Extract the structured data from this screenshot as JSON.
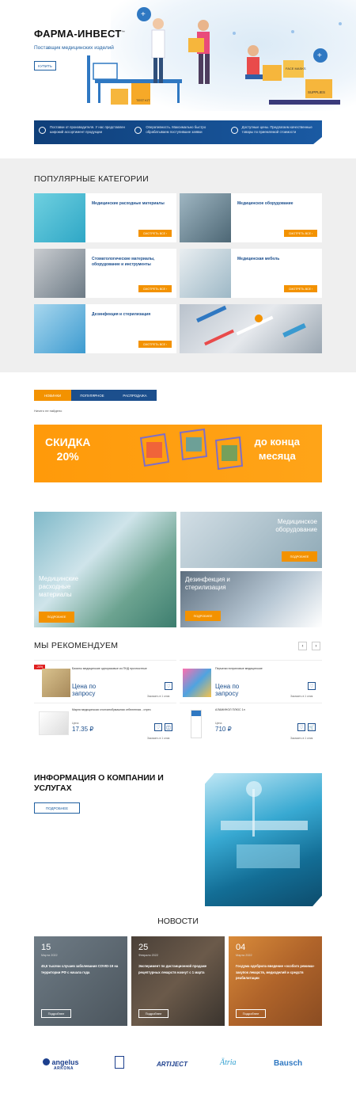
{
  "hero": {
    "title": "ФАРМА-ИНВЕСТ",
    "title_tm": "™",
    "subtitle": "Поставщик медицинских изделий",
    "buy_button": "КУПИТЬ",
    "sign_test_kit": "TEST KIT",
    "sign_face_masks": "FACE MASKS",
    "sign_supplies": "SUPPLIES"
  },
  "features": [
    {
      "icon": "truck-icon",
      "text": "Поставки от производителя. У нас представлен широкий ассортимент продукции"
    },
    {
      "icon": "handshake-icon",
      "text": "Оперативность. Максимально быстро обрабатываем поступившие заявки"
    },
    {
      "icon": "price-icon",
      "text": "Доступные цены. Предлагаем качественные товары по приемлемой стоимости"
    }
  ],
  "categories": {
    "title": "ПОПУЛЯРНЫЕ КАТЕГОРИИ",
    "button_label": "СМОТРЕТЬ ВСЕ",
    "items": [
      {
        "name": "Медицинские расходные материалы"
      },
      {
        "name": "Медицинское оборудование"
      },
      {
        "name": "Стоматологические материалы, оборудование и инструменты"
      },
      {
        "name": "Медицинская мебель"
      },
      {
        "name": "Дезинфекция и стерилизация"
      }
    ]
  },
  "tabs": {
    "items": [
      "НОВИНКИ",
      "ПОПУЛЯРНОЕ",
      "РАСПРОДАЖА"
    ],
    "empty_text": "Ничего не найдено"
  },
  "promo": {
    "left_line1": "СКИДКА",
    "left_line2": "20%",
    "right_line1": "до конца",
    "right_line2": "месяца"
  },
  "tiles": {
    "button_label": "ПОДРОБНЕЕ",
    "left_label": "Медицинские расходные материалы",
    "top_right_label": "Медицинское оборудование",
    "bottom_right_label": "Дезинфекция и стерилизация"
  },
  "recommend": {
    "title": "МЫ РЕКОМЕНДУЕМ",
    "order_label": "Заказать в 1 клик",
    "products": [
      {
        "name": "Бахилы медицинские одноразовые из ПНД прочностные",
        "price": "Цена по запросу",
        "badge": "-20%"
      },
      {
        "name": "Перчатки нитриловые медицинские",
        "price": "Цена по запросу"
      },
      {
        "name": "Марля медицинская хлопчатобумажная отбеленная - отрез",
        "price_prefix": "Цена",
        "price": "17.35 ₽"
      },
      {
        "name": "АЛАМИНОЛ ПЛЮС 1л",
        "price_prefix": "Цена",
        "price": "710 ₽"
      }
    ]
  },
  "about": {
    "title": "ИНФОРМАЦИЯ О КОМПАНИИ И УСЛУГАХ",
    "button_label": "ПОДРОБНЕЕ"
  },
  "news": {
    "title": "НОВОСТИ",
    "more_label": "Подробнее",
    "items": [
      {
        "day": "15",
        "month": "Марта 2022",
        "text": "45,6 тысячи случаев заболевания COVID-19 на территории РФ с начала года"
      },
      {
        "day": "25",
        "month": "Февраля 2022",
        "text": "Эксперимент по дистанционной продаже рецептурных лекарств начнут с 1 марта"
      },
      {
        "day": "04",
        "month": "Марта 2022",
        "text": "Госдума одобрила введение «особого режима» закупок лекарств, медизделий и средств реабилитации"
      }
    ]
  },
  "brands": [
    "angelus",
    "ARKONA",
    "ARTIJECT",
    "Ätria",
    "Bausch"
  ]
}
